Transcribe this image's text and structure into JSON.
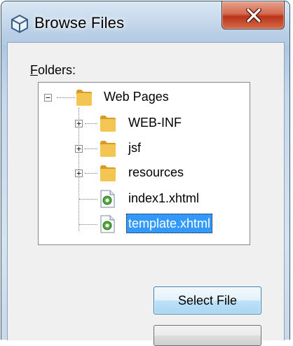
{
  "window": {
    "title": "Browse Files",
    "close_label": "X"
  },
  "folders": {
    "label_accesskey": "F",
    "label_rest": "olders:"
  },
  "tree": {
    "root": {
      "label": "Web Pages",
      "icon": "folder-icon",
      "expanded": true
    },
    "children": [
      {
        "label": "WEB-INF",
        "icon": "folder-icon",
        "expandable": true
      },
      {
        "label": "jsf",
        "icon": "folder-icon",
        "expandable": true
      },
      {
        "label": "resources",
        "icon": "folder-icon",
        "expandable": true
      },
      {
        "label": "index1.xhtml",
        "icon": "xhtml-file-icon",
        "expandable": false
      },
      {
        "label": "template.xhtml",
        "icon": "xhtml-file-icon",
        "expandable": false,
        "selected": true
      }
    ]
  },
  "buttons": {
    "select_file": "Select File"
  },
  "colors": {
    "selection": "#3399ff",
    "folder": "#e8b03a",
    "close_button": "#c4452b"
  }
}
